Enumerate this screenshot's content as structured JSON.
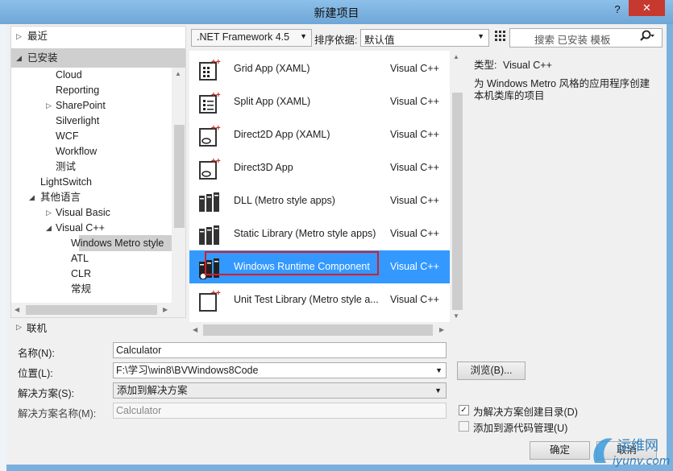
{
  "window": {
    "title": "新建项目",
    "help": "?",
    "close": "✕"
  },
  "tree": {
    "recent": "最近",
    "installed": "已安装",
    "items": [
      "Cloud",
      "Reporting",
      "SharePoint",
      "Silverlight",
      "WCF",
      "Workflow",
      "测试",
      "LightSwitch",
      "其他语言",
      "Visual Basic",
      "Visual C++",
      "Windows Metro style",
      "ATL",
      "CLR",
      "常规"
    ],
    "online": "联机"
  },
  "toolbar": {
    "framework": ".NET Framework 4.5",
    "sort_label": "排序依据:",
    "sort_value": "默认值",
    "search_placeholder": "搜索 已安装 模板"
  },
  "templates": [
    {
      "name": "Grid App (XAML)",
      "lang": "Visual C++"
    },
    {
      "name": "Split App (XAML)",
      "lang": "Visual C++"
    },
    {
      "name": "Direct2D App (XAML)",
      "lang": "Visual C++"
    },
    {
      "name": "Direct3D App",
      "lang": "Visual C++"
    },
    {
      "name": "DLL (Metro style apps)",
      "lang": "Visual C++"
    },
    {
      "name": "Static Library (Metro style apps)",
      "lang": "Visual C++"
    },
    {
      "name": "Windows Runtime Component",
      "lang": "Visual C++",
      "selected": true
    },
    {
      "name": "Unit Test Library (Metro style a...",
      "lang": "Visual C++"
    }
  ],
  "description": {
    "type_label": "类型:",
    "type_value": "Visual C++",
    "text": "为 Windows Metro 风格的应用程序创建本机类库的项目"
  },
  "form": {
    "name_label": "名称(N):",
    "name_value": "Calculator",
    "location_label": "位置(L):",
    "location_value": "F:\\学习\\win8\\BVWindows8Code",
    "solution_label": "解决方案(S):",
    "solution_value": "添加到解决方案",
    "solution_name_label": "解决方案名称(M):",
    "solution_name_value": "Calculator",
    "browse": "浏览(B)...",
    "create_dir": "为解决方案创建目录(D)",
    "create_dir_checked": true,
    "add_source_control": "添加到源代码管理(U)",
    "add_source_control_checked": false,
    "ok": "确定",
    "cancel": "取消"
  },
  "watermark": {
    "cn": "运维网",
    "url": "iyunv.com"
  },
  "colors": {
    "selection": "#3399ff",
    "highlight_box": "#d0202a"
  }
}
